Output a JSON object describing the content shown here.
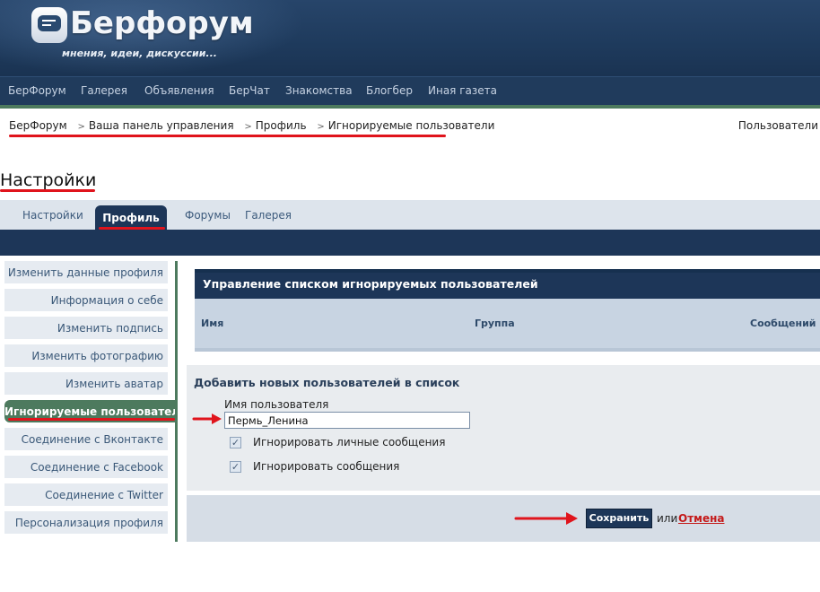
{
  "header": {
    "logo_text": "Берфорум",
    "tagline": "мнения, идеи, дискуссии..."
  },
  "topnav": [
    "БерФорум",
    "Галерея",
    "Объявления",
    "БерЧат",
    "Знакомства",
    "Блогбер",
    "Иная газета"
  ],
  "breadcrumb": [
    "БерФорум",
    "Ваша панель управления",
    "Профиль",
    "Игнорируемые пользователи"
  ],
  "breadcrumb_separator": ">",
  "users_link": "Пользователи",
  "page_title": "Настройки",
  "tabs": [
    "Настройки",
    "Профиль",
    "Форумы",
    "Галерея"
  ],
  "active_tab": "Профиль",
  "sidebar": [
    "Изменить данные профиля",
    "Информация о себе",
    "Изменить подпись",
    "Изменить фотографию",
    "Изменить аватар",
    "Игнорируемые пользователи",
    "Соединение с Вконтакте",
    "Соединение с Facebook",
    "Соединение с Twitter",
    "Персонализация профиля"
  ],
  "active_sidebar": "Игнорируемые пользователи",
  "ignore_panel": {
    "title": "Управление списком игнорируемых пользователей",
    "columns": [
      "Имя",
      "Группа",
      "Сообщений"
    ]
  },
  "add_form": {
    "title": "Добавить новых пользователей в список",
    "username_label": "Имя пользователя",
    "username_value": "Пермь_Ленина",
    "options": [
      {
        "label": "Игнорировать личные сообщения",
        "checked": true
      },
      {
        "label": "Игнорировать сообщения",
        "checked": true
      }
    ]
  },
  "actions": {
    "save": "Сохранить",
    "or": "или",
    "cancel": "Отмена"
  },
  "colors": {
    "navy": "#1d3658",
    "green_accent": "#4d7a5e",
    "annotation_red": "#e0141c",
    "cancel_red": "#c41a1a"
  }
}
